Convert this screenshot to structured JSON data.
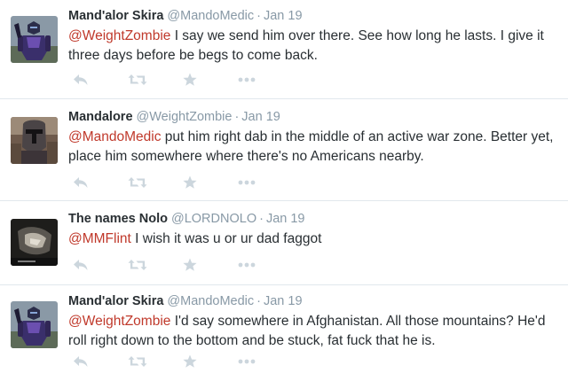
{
  "colors": {
    "mention": "#c0392b",
    "muted": "#8899a6",
    "text": "#292f33",
    "icon": "#ccd6dd",
    "divider": "#e1e8ed"
  },
  "tweets": [
    {
      "name": "Mand'alor Skira",
      "handle": "@MandoMedic",
      "separator": "·",
      "date": "Jan 19",
      "mention": "@WeightZombie",
      "body": " I say we send him over there. See how long he lasts. I give it three days before be begs to come back.",
      "avatar": "armored-figure-purple"
    },
    {
      "name": "Mandalore",
      "handle": "@WeightZombie",
      "separator": "·",
      "date": "Jan 19",
      "mention": "@MandoMedic",
      "body": " put him right dab in the middle of an active war zone. Better yet, place him somewhere where there's no Americans nearby.",
      "avatar": "helmet-portrait"
    },
    {
      "name": "The names Nolo",
      "handle": "@LORDNOLO",
      "separator": "·",
      "date": "Jan 19",
      "mention": "@MMFlint",
      "body": " I wish it was u or ur dad faggot",
      "avatar": "dark-photo-hand"
    },
    {
      "name": "Mand'alor Skira",
      "handle": "@MandoMedic",
      "separator": "·",
      "date": "Jan 19",
      "mention": "@WeightZombie",
      "body": " I'd say somewhere in Afghanistan. All those mountains? He'd roll right down to the bottom and be stuck, fat fuck that he is.",
      "avatar": "armored-figure-purple"
    }
  ],
  "action_icons": [
    "reply-icon",
    "retweet-icon",
    "favorite-icon",
    "more-icon"
  ]
}
